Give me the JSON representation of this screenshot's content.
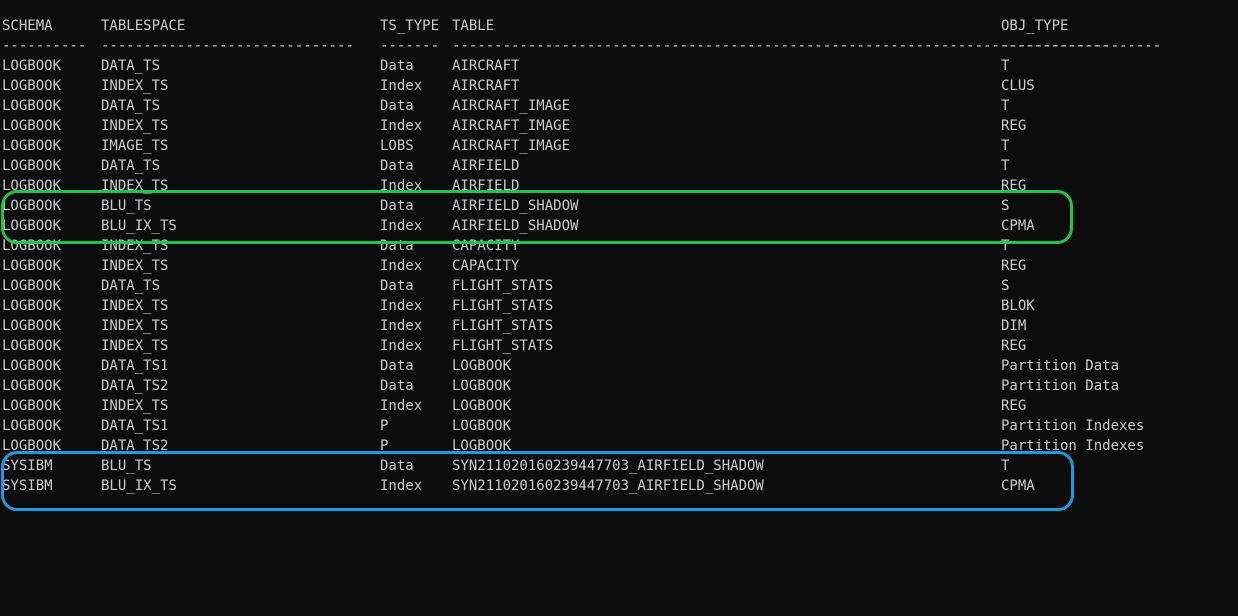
{
  "columns": {
    "schema": "SCHEMA",
    "tablespace": "TABLESPACE",
    "ts_type": "TS_TYPE",
    "table": "TABLE",
    "obj_type": "OBJ_TYPE"
  },
  "separators": {
    "schema": "----------",
    "tablespace": "------------------------------",
    "ts_type": "-------",
    "table": "------------------------------------------------------------------------------",
    "obj_type": "-------------------"
  },
  "rows": [
    [
      "LOGBOOK",
      "DATA_TS",
      "Data",
      "AIRCRAFT",
      "T"
    ],
    [
      "LOGBOOK",
      "INDEX_TS",
      "Index",
      "AIRCRAFT",
      "CLUS"
    ],
    [
      "LOGBOOK",
      "DATA_TS",
      "Data",
      "AIRCRAFT_IMAGE",
      "T"
    ],
    [
      "LOGBOOK",
      "INDEX_TS",
      "Index",
      "AIRCRAFT_IMAGE",
      "REG"
    ],
    [
      "LOGBOOK",
      "IMAGE_TS",
      "LOBS",
      "AIRCRAFT_IMAGE",
      "T"
    ],
    [
      "LOGBOOK",
      "DATA_TS",
      "Data",
      "AIRFIELD",
      "T"
    ],
    [
      "LOGBOOK",
      "INDEX_TS",
      "Index",
      "AIRFIELD",
      "REG"
    ],
    [
      "LOGBOOK",
      "BLU_TS",
      "Data",
      "AIRFIELD_SHADOW",
      "S"
    ],
    [
      "LOGBOOK",
      "BLU_IX_TS",
      "Index",
      "AIRFIELD_SHADOW",
      "CPMA"
    ],
    [
      "LOGBOOK",
      "INDEX_TS",
      "Data",
      "CAPACITY",
      "T"
    ],
    [
      "LOGBOOK",
      "INDEX_TS",
      "Index",
      "CAPACITY",
      "REG"
    ],
    [
      "LOGBOOK",
      "DATA_TS",
      "Data",
      "FLIGHT_STATS",
      "S"
    ],
    [
      "LOGBOOK",
      "INDEX_TS",
      "Index",
      "FLIGHT_STATS",
      "BLOK"
    ],
    [
      "LOGBOOK",
      "INDEX_TS",
      "Index",
      "FLIGHT_STATS",
      "DIM"
    ],
    [
      "LOGBOOK",
      "INDEX_TS",
      "Index",
      "FLIGHT_STATS",
      "REG"
    ],
    [
      "LOGBOOK",
      "DATA_TS1",
      "Data",
      "LOGBOOK",
      "Partition Data"
    ],
    [
      "LOGBOOK",
      "DATA_TS2",
      "Data",
      "LOGBOOK",
      "Partition Data"
    ],
    [
      "LOGBOOK",
      "INDEX_TS",
      "Index",
      "LOGBOOK",
      "REG"
    ],
    [
      "LOGBOOK",
      "DATA_TS1",
      "P",
      "LOGBOOK",
      "Partition Indexes"
    ],
    [
      "LOGBOOK",
      "DATA_TS2",
      "P",
      "LOGBOOK",
      "Partition Indexes"
    ],
    [
      "SYSIBM",
      "BLU_TS",
      "Data",
      "SYN211020160239447703_AIRFIELD_SHADOW",
      "T"
    ],
    [
      "SYSIBM",
      "BLU_IX_TS",
      "Index",
      "SYN211020160239447703_AIRFIELD_SHADOW",
      "CPMA"
    ]
  ],
  "colors": {
    "background": "#0c0c0c",
    "text": "#cccccc",
    "highlight_green": "#22c34a",
    "highlight_blue": "#1e9be0"
  }
}
